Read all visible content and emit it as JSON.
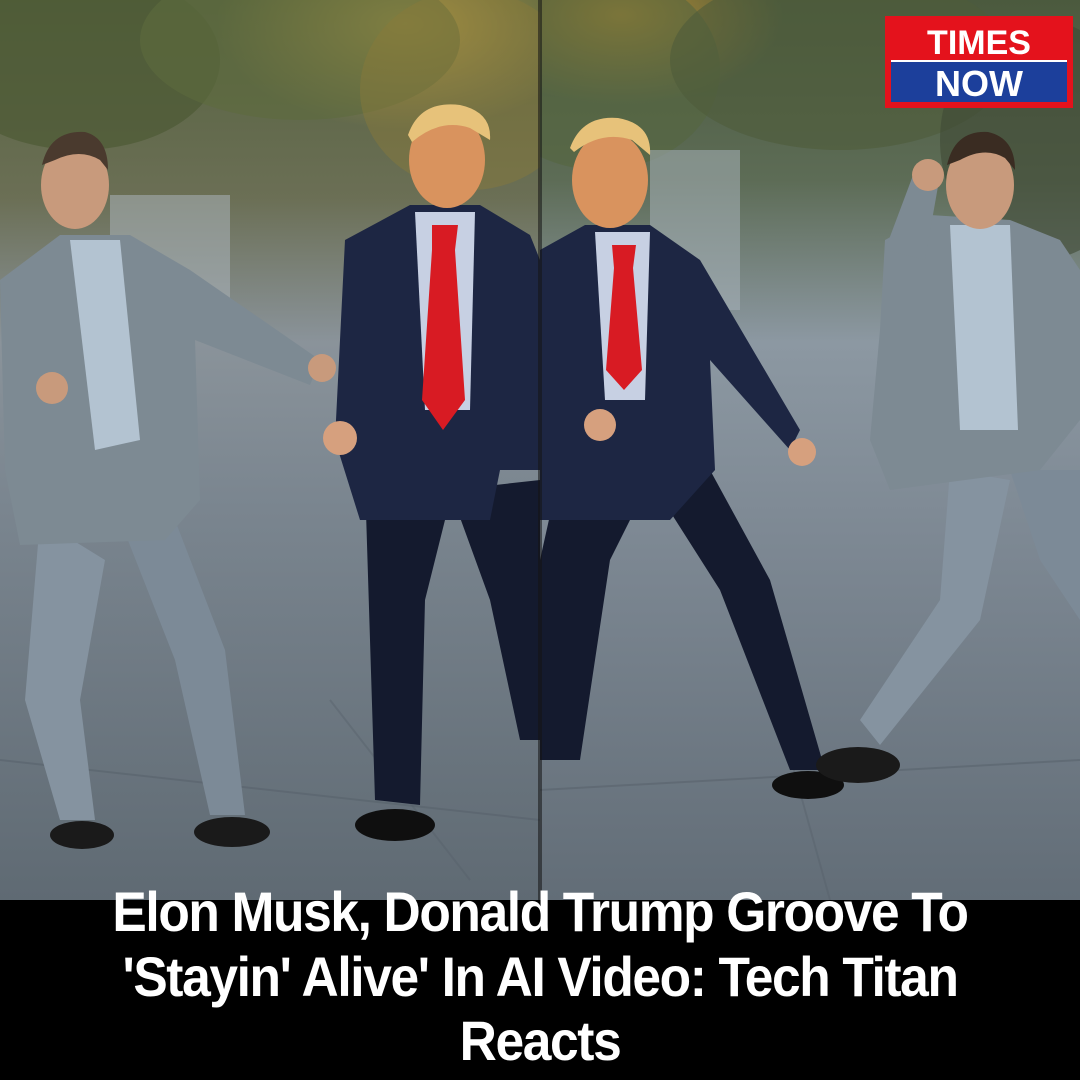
{
  "brand": {
    "logo_line1": "TIMES",
    "logo_line2": "NOW",
    "logo_red": "#e4121c",
    "logo_blue": "#1c3f9b"
  },
  "headline": {
    "text": "Elon Musk, Donald Trump Groove To 'Stayin' Alive' In AI Video: Tech Titan Reacts"
  },
  "colors": {
    "background": "#000000",
    "headline_text": "#ffffff",
    "tie_red": "#d81b23",
    "navy_suit": "#1d2643",
    "grey_suit": "#7d8a93"
  }
}
